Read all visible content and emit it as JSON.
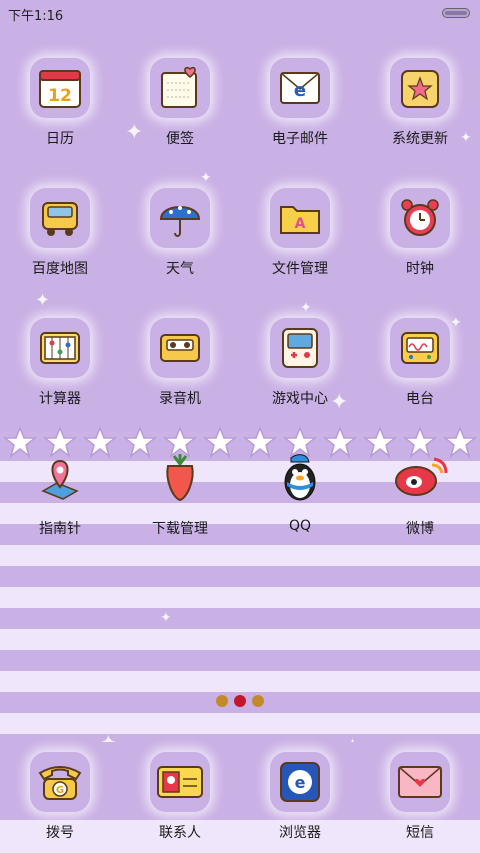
{
  "status_bar": {
    "time": "下午1:16"
  },
  "page_indicator": {
    "count": 3,
    "active_index": 1,
    "colors": {
      "active": "#c0172a",
      "inactive": "#c38a2a"
    }
  },
  "rows": [
    [
      {
        "label": "日历",
        "icon": "calendar-icon"
      },
      {
        "label": "便签",
        "icon": "notepad-icon"
      },
      {
        "label": "电子邮件",
        "icon": "email-icon"
      },
      {
        "label": "系统更新",
        "icon": "system-update-icon"
      }
    ],
    [
      {
        "label": "百度地图",
        "icon": "bus-map-icon"
      },
      {
        "label": "天气",
        "icon": "umbrella-icon"
      },
      {
        "label": "文件管理",
        "icon": "folder-icon"
      },
      {
        "label": "时钟",
        "icon": "alarm-clock-icon"
      }
    ],
    [
      {
        "label": "计算器",
        "icon": "abacus-icon"
      },
      {
        "label": "录音机",
        "icon": "cassette-icon"
      },
      {
        "label": "游戏中心",
        "icon": "gamepad-icon"
      },
      {
        "label": "电台",
        "icon": "radio-icon"
      }
    ],
    [
      {
        "label": "指南针",
        "icon": "map-pin-icon"
      },
      {
        "label": "下载管理",
        "icon": "carrot-icon"
      },
      {
        "label": "QQ",
        "icon": "penguin-icon"
      },
      {
        "label": "微博",
        "icon": "weibo-icon"
      }
    ]
  ],
  "dock": [
    {
      "label": "拨号",
      "icon": "telephone-icon"
    },
    {
      "label": "联系人",
      "icon": "contact-card-icon"
    },
    {
      "label": "浏览器",
      "icon": "browser-icon"
    },
    {
      "label": "短信",
      "icon": "envelope-icon"
    }
  ],
  "calendar_day": "12",
  "theme_colors": {
    "lavender": "#c9b0e5",
    "stripe_light": "#efe6fb"
  }
}
